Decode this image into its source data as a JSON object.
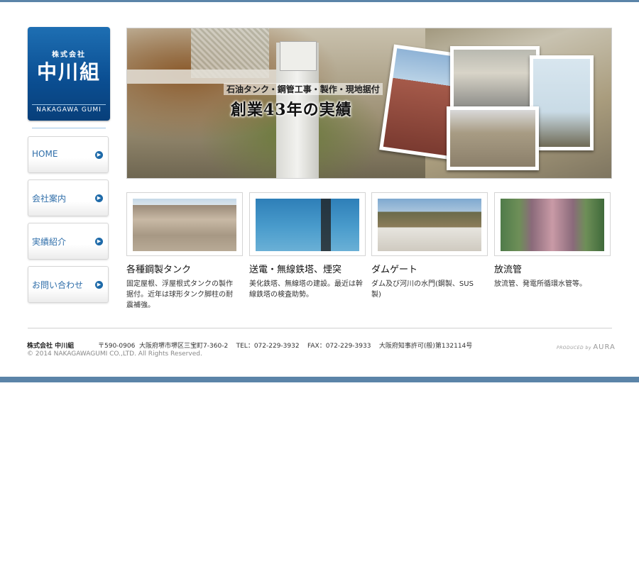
{
  "logo": {
    "prefix": "株式会社",
    "name": "中川組",
    "romanized": "NAKAGAWA GUMI"
  },
  "nav": [
    {
      "label": "HOME"
    },
    {
      "label": "会社案内"
    },
    {
      "label": "実績紹介"
    },
    {
      "label": "お問い合わせ"
    }
  ],
  "hero": {
    "subtitle": "石油タンク・鋼管工事・製作・現地据付",
    "title": "創業43年の実績"
  },
  "services": [
    {
      "title": "各種鋼製タンク",
      "text": "固定屋根、浮屋根式タンクの製作据付。近年は球形タンク脚柱の耐震補強。"
    },
    {
      "title": "送電・無線鉄塔、煙突",
      "text": "美化鉄塔、無線塔の建設。最近は幹線鉄塔の検査助勢。"
    },
    {
      "title": "ダムゲート",
      "text": "ダム及び河川の水門(鋼製、SUS製)"
    },
    {
      "title": "放流管",
      "text": "放流管、発電所循環水管等。"
    }
  ],
  "footer": {
    "company": "株式会社 中川組",
    "address_line": "〒590-0906  大阪府堺市堺区三宝町7-360-2    TEL：072-229-3932    FAX：072-229-3933    大阪府知事許可(般)第132114号",
    "copyright": "© 2014 NAKAGAWAGUMI CO.,LTD. All Rights Reserved.",
    "produced_by": "PRODUCED by",
    "produced_brand": "AURA"
  },
  "colors": {
    "accent": "#5b84a8",
    "logo_blue": "#0b4f93",
    "nav_text": "#2f6ea9"
  },
  "icons": {
    "nav_arrow": "chevron-right-circle-icon"
  }
}
